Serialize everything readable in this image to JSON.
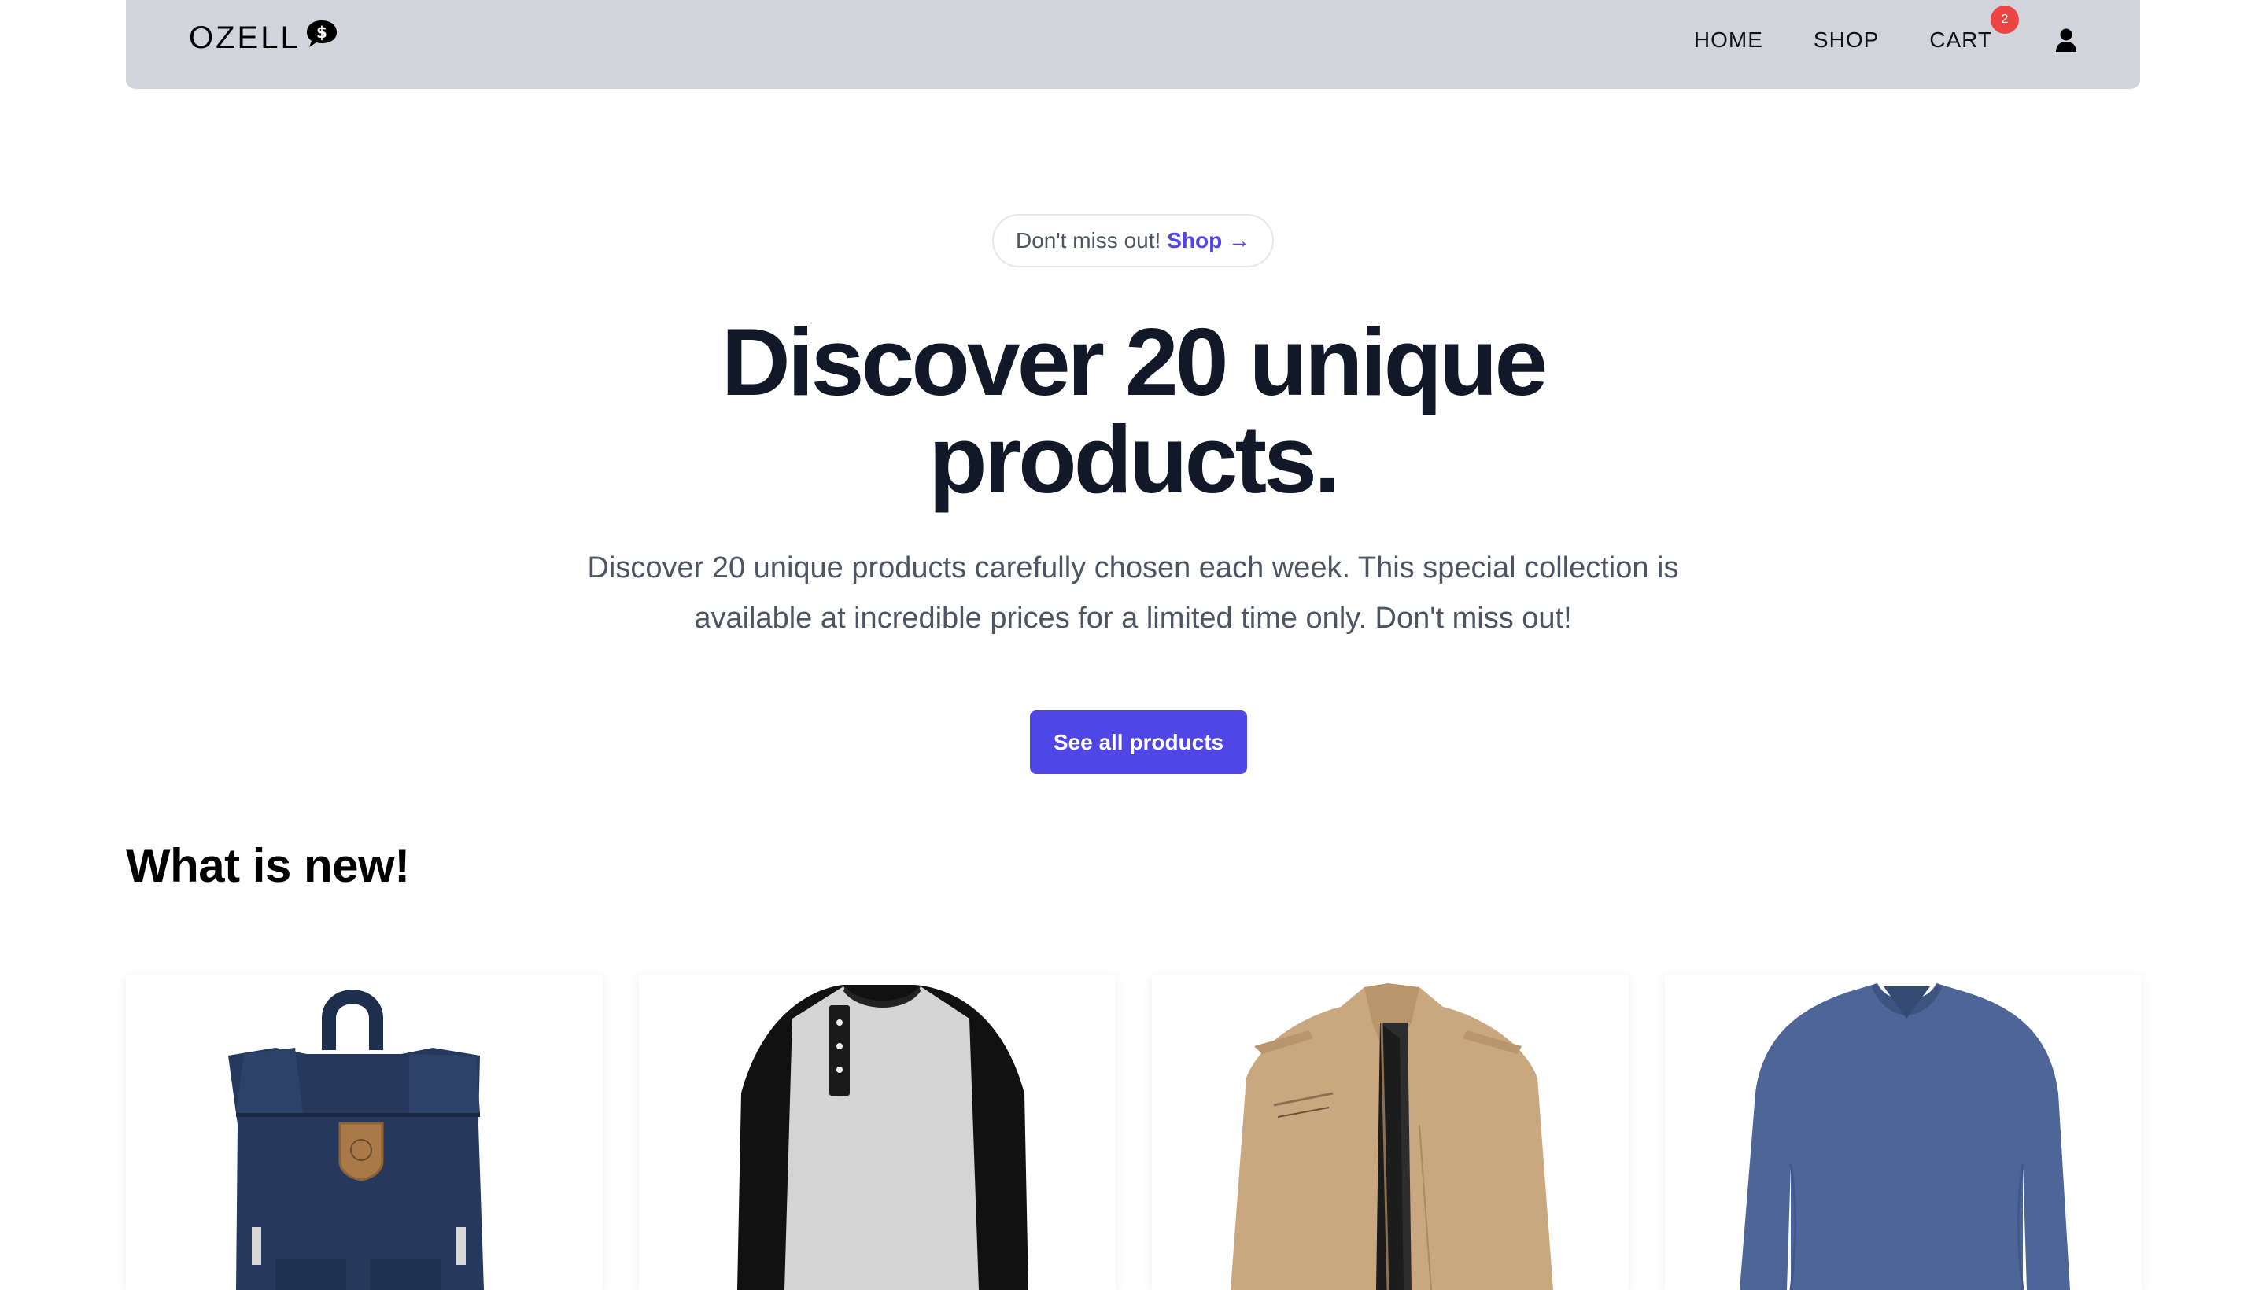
{
  "brand": {
    "name": "OZELL",
    "logo_icon": "dollar-speech-bubble-icon"
  },
  "nav": {
    "home": "HOME",
    "shop": "SHOP",
    "cart": "CART",
    "cart_count": "2",
    "user_icon": "user-icon"
  },
  "announcement": {
    "text": "Don't miss out!",
    "link": "Shop →"
  },
  "hero": {
    "title_line1": "Discover 20 unique",
    "title_line2": "products.",
    "description": "Discover 20 unique products carefully chosen each week. This special collection is available at incredible prices for a limited time only. Don't miss out!",
    "cta": "See all products"
  },
  "new_section": {
    "title": "What is new!",
    "products": [
      {
        "image": "navy-backpack"
      },
      {
        "image": "black-grey-henley-shirt"
      },
      {
        "image": "beige-jacket"
      },
      {
        "image": "blue-vneck-longsleeve"
      }
    ]
  },
  "colors": {
    "accent": "#4f46e5",
    "navbar_bg": "#d1d5db",
    "badge": "#ef4444"
  }
}
